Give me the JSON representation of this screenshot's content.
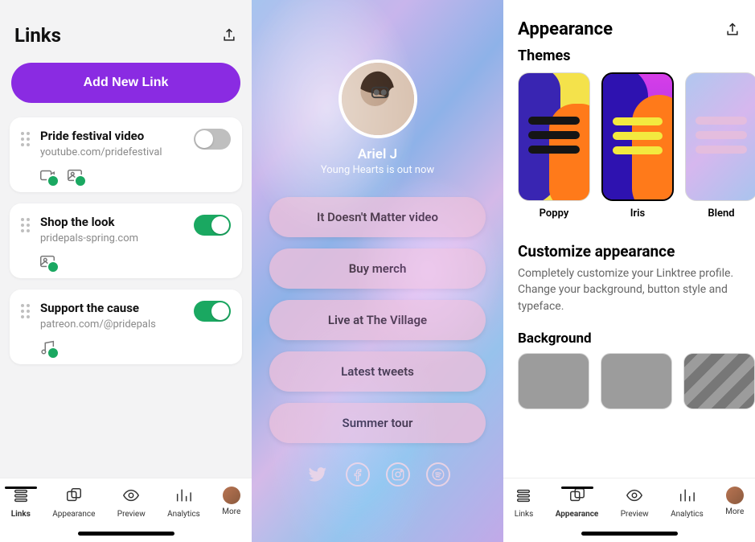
{
  "left": {
    "title": "Links",
    "add_label": "Add New Link",
    "links": [
      {
        "title": "Pride festival video",
        "url": "youtube.com/pridefestival",
        "on": false,
        "icons": [
          "video",
          "image"
        ]
      },
      {
        "title": "Shop the look",
        "url": "pridepals-spring.com",
        "on": true,
        "icons": [
          "image"
        ]
      },
      {
        "title": "Support the cause",
        "url": "patreon.com/@pridepals",
        "on": true,
        "icons": [
          "music"
        ]
      }
    ],
    "tabs": [
      "Links",
      "Appearance",
      "Preview",
      "Analytics",
      "More"
    ],
    "active_tab": 0
  },
  "middle": {
    "name": "Ariel J",
    "tagline": "Young Hearts is out now",
    "links": [
      "It Doesn't Matter video",
      "Buy merch",
      "Live at The Village",
      "Latest tweets",
      "Summer tour"
    ],
    "socials": [
      "twitter",
      "facebook",
      "instagram",
      "spotify"
    ]
  },
  "right": {
    "title": "Appearance",
    "themes_heading": "Themes",
    "themes": [
      {
        "name": "Poppy",
        "selected": false,
        "cls": "tp-poppy"
      },
      {
        "name": "Iris",
        "selected": true,
        "cls": "tp-iris"
      },
      {
        "name": "Blend",
        "selected": false,
        "cls": "tp-blend"
      }
    ],
    "customize_heading": "Customize appearance",
    "customize_body": "Completely customize your Linktree profile. Change your background, button style and typeface.",
    "background_heading": "Background",
    "tabs": [
      "Links",
      "Appearance",
      "Preview",
      "Analytics",
      "More"
    ],
    "active_tab": 1
  }
}
